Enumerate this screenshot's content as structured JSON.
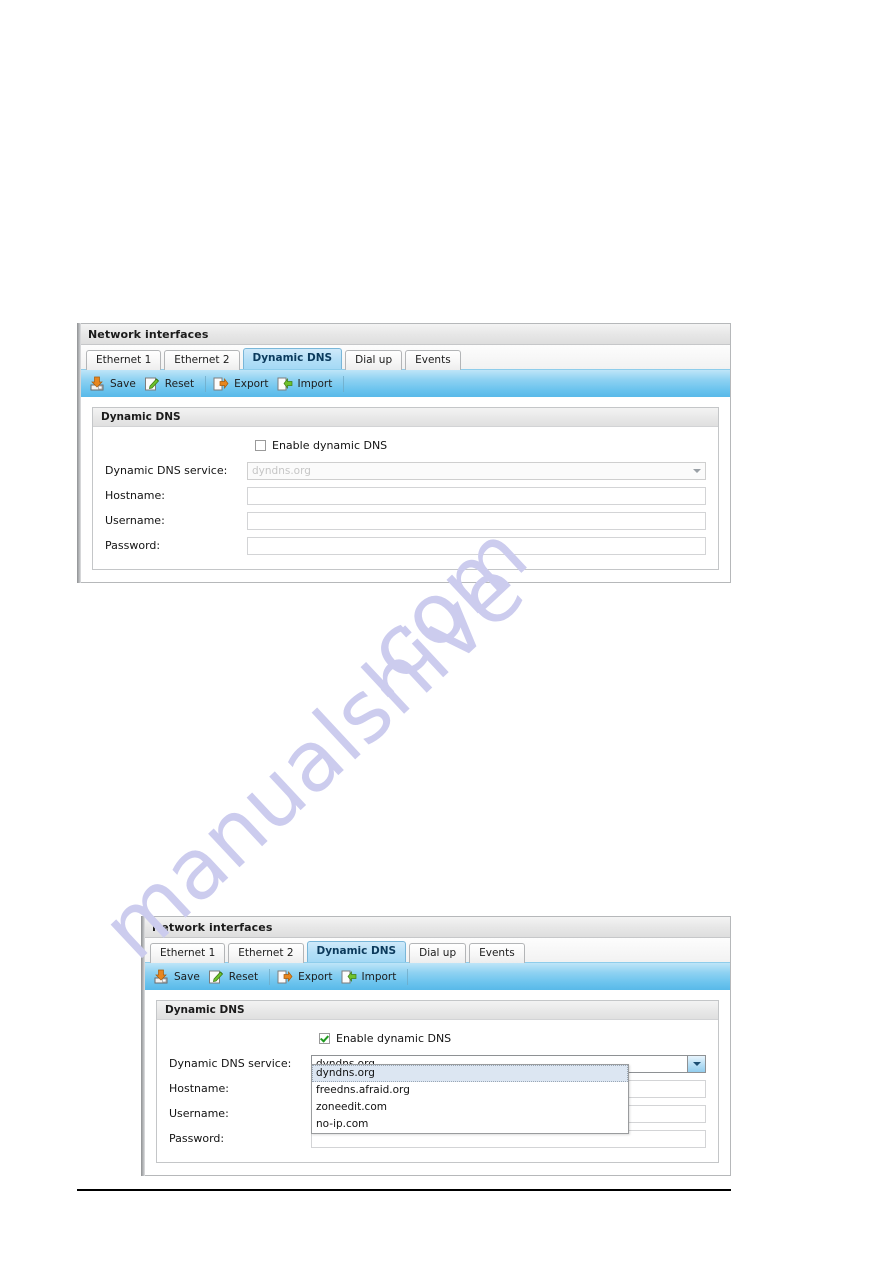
{
  "watermark": {
    "line1": "manualshive",
    "line2": ".com"
  },
  "panels": [
    {
      "window_title": "Network interfaces",
      "tabs": [
        {
          "label": "Ethernet 1",
          "active": false
        },
        {
          "label": "Ethernet 2",
          "active": false
        },
        {
          "label": "Dynamic DNS",
          "active": true
        },
        {
          "label": "Dial up",
          "active": false
        },
        {
          "label": "Events",
          "active": false
        }
      ],
      "toolbar": {
        "save_label": "Save",
        "reset_label": "Reset",
        "export_label": "Export",
        "import_label": "Import",
        "icons": {
          "save": "save-disk-icon",
          "reset": "reset-pencil-icon",
          "export": "export-arrow-icon",
          "import": "import-arrow-icon"
        }
      },
      "group": {
        "title": "Dynamic DNS",
        "enable_checkbox": {
          "label": "Enable dynamic DNS",
          "checked": false
        },
        "fields": {
          "service_label": "Dynamic DNS service:",
          "service_value": "dyndns.org",
          "service_disabled": true,
          "hostname_label": "Hostname:",
          "hostname_value": "",
          "username_label": "Username:",
          "username_value": "",
          "password_label": "Password:",
          "password_value": ""
        }
      },
      "dropdown_open": false
    },
    {
      "window_title": "Network interfaces",
      "tabs": [
        {
          "label": "Ethernet 1",
          "active": false
        },
        {
          "label": "Ethernet 2",
          "active": false
        },
        {
          "label": "Dynamic DNS",
          "active": true
        },
        {
          "label": "Dial up",
          "active": false
        },
        {
          "label": "Events",
          "active": false
        }
      ],
      "toolbar": {
        "save_label": "Save",
        "reset_label": "Reset",
        "export_label": "Export",
        "import_label": "Import",
        "icons": {
          "save": "save-disk-icon",
          "reset": "reset-pencil-icon",
          "export": "export-arrow-icon",
          "import": "import-arrow-icon"
        }
      },
      "group": {
        "title": "Dynamic DNS",
        "enable_checkbox": {
          "label": "Enable dynamic DNS",
          "checked": true
        },
        "fields": {
          "service_label": "Dynamic DNS service:",
          "service_value": "dyndns.org",
          "service_disabled": false,
          "hostname_label": "Hostname:",
          "hostname_value": "",
          "username_label": "Username:",
          "username_value": "",
          "password_label": "Password:",
          "password_value": ""
        }
      },
      "dropdown_open": true,
      "dropdown_options": [
        {
          "label": "dyndns.org",
          "highlighted": true
        },
        {
          "label": "freedns.afraid.org",
          "highlighted": false
        },
        {
          "label": "zoneedit.com",
          "highlighted": false
        },
        {
          "label": "no-ip.com",
          "highlighted": false
        }
      ]
    }
  ],
  "colors": {
    "toolbar_blue": "#6cc4ee",
    "active_tab_blue": "#b3dff7",
    "highlight_blue": "#dce6f2",
    "watermark_lavender": "#ccccee",
    "save_icon_orange": "#e8861e",
    "reset_icon_green": "#4caa22",
    "check_green": "#1f9b1f"
  }
}
